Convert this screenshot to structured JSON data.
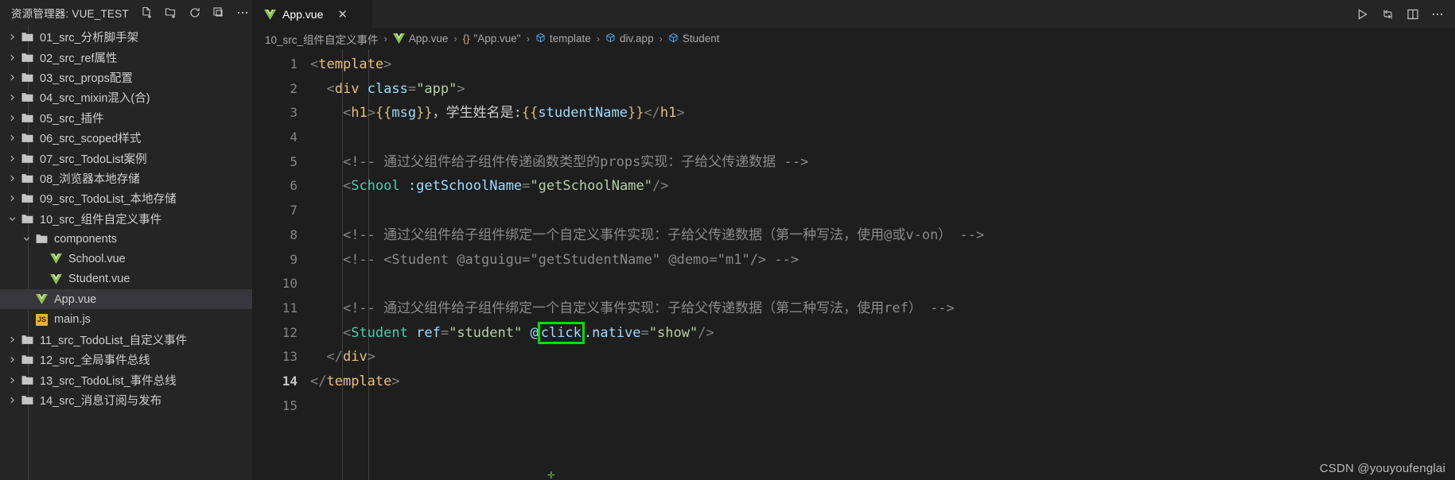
{
  "sidebar": {
    "title": "资源管理器: VUE_TEST",
    "actions": [
      {
        "name": "new-file-icon",
        "tooltip": "新建文件"
      },
      {
        "name": "new-folder-icon",
        "tooltip": "新建文件夹"
      },
      {
        "name": "refresh-icon",
        "tooltip": "刷新资源管理器"
      },
      {
        "name": "collapse-all-icon",
        "tooltip": "在资源管理器中折叠文件夹"
      },
      {
        "name": "more-actions-icon",
        "tooltip": "视图和更多操作"
      }
    ],
    "items": [
      {
        "label": "01_src_分析脚手架",
        "type": "folder",
        "expanded": false,
        "indent": 1,
        "selected": false
      },
      {
        "label": "02_src_ref属性",
        "type": "folder",
        "expanded": false,
        "indent": 1,
        "selected": false
      },
      {
        "label": "03_src_props配置",
        "type": "folder",
        "expanded": false,
        "indent": 1,
        "selected": false
      },
      {
        "label": "04_src_mixin混入(合)",
        "type": "folder",
        "expanded": false,
        "indent": 1,
        "selected": false
      },
      {
        "label": "05_src_插件",
        "type": "folder",
        "expanded": false,
        "indent": 1,
        "selected": false
      },
      {
        "label": "06_src_scoped样式",
        "type": "folder",
        "expanded": false,
        "indent": 1,
        "selected": false
      },
      {
        "label": "07_src_TodoList案例",
        "type": "folder",
        "expanded": false,
        "indent": 1,
        "selected": false
      },
      {
        "label": "08_浏览器本地存储",
        "type": "folder",
        "expanded": false,
        "indent": 1,
        "selected": false
      },
      {
        "label": "09_src_TodoList_本地存储",
        "type": "folder",
        "expanded": false,
        "indent": 1,
        "selected": false
      },
      {
        "label": "10_src_组件自定义事件",
        "type": "folder",
        "expanded": true,
        "indent": 1,
        "selected": false
      },
      {
        "label": "components",
        "type": "folder",
        "expanded": true,
        "indent": 2,
        "selected": false
      },
      {
        "label": "School.vue",
        "type": "vue",
        "indent": 3,
        "selected": false
      },
      {
        "label": "Student.vue",
        "type": "vue",
        "indent": 3,
        "selected": false
      },
      {
        "label": "App.vue",
        "type": "vue",
        "indent": 2,
        "selected": true
      },
      {
        "label": "main.js",
        "type": "js",
        "indent": 2,
        "selected": false
      },
      {
        "label": "11_src_TodoList_自定义事件",
        "type": "folder",
        "expanded": false,
        "indent": 1,
        "selected": false
      },
      {
        "label": "12_src_全局事件总线",
        "type": "folder",
        "expanded": false,
        "indent": 1,
        "selected": false
      },
      {
        "label": "13_src_TodoList_事件总线",
        "type": "folder",
        "expanded": false,
        "indent": 1,
        "selected": false
      },
      {
        "label": "14_src_消息订阅与发布",
        "type": "folder",
        "expanded": false,
        "indent": 1,
        "selected": false
      }
    ]
  },
  "tabs": {
    "active": {
      "label": "App.vue",
      "icon": "vue-icon",
      "close": "✕"
    },
    "actions": [
      {
        "name": "run-icon",
        "label": "▷"
      },
      {
        "name": "split-run-icon",
        "label": ""
      },
      {
        "name": "split-editor-icon",
        "label": ""
      },
      {
        "name": "more-editor-actions-icon",
        "label": "⋯"
      }
    ]
  },
  "breadcrumb": [
    {
      "label": "10_src_组件自定义事件",
      "icon": "none"
    },
    {
      "label": "App.vue",
      "icon": "vue-icon"
    },
    {
      "label": "\"App.vue\"",
      "icon": "braces-icon"
    },
    {
      "label": "template",
      "icon": "cube-icon"
    },
    {
      "label": "div.app",
      "icon": "cube-icon"
    },
    {
      "label": "Student",
      "icon": "cube-icon"
    }
  ],
  "editor": {
    "line_numbers": [
      "1",
      "2",
      "3",
      "4",
      "5",
      "6",
      "7",
      "8",
      "9",
      "10",
      "11",
      "12",
      "13",
      "14",
      "15"
    ],
    "active_line": 14,
    "highlight_color": "#00dd00",
    "highlighted_token": "click",
    "lines": [
      {
        "n": 1,
        "text": "<template>"
      },
      {
        "n": 2,
        "text": "  <div class=\"app\">"
      },
      {
        "n": 3,
        "text": "    <h1>{{msg}}，学生姓名是:{{studentName}}</h1>"
      },
      {
        "n": 4,
        "text": ""
      },
      {
        "n": 5,
        "text": "    <!-- 通过父组件给子组件传递函数类型的props实现：子给父传递数据 -->"
      },
      {
        "n": 6,
        "text": "    <School :getSchoolName=\"getSchoolName\"/>"
      },
      {
        "n": 7,
        "text": ""
      },
      {
        "n": 8,
        "text": "    <!-- 通过父组件给子组件绑定一个自定义事件实现：子给父传递数据（第一种写法，使用@或v-on） -->"
      },
      {
        "n": 9,
        "text": "    <!-- <Student @atguigu=\"getStudentName\" @demo=\"m1\"/> -->"
      },
      {
        "n": 10,
        "text": ""
      },
      {
        "n": 11,
        "text": "    <!-- 通过父组件给子组件绑定一个自定义事件实现：子给父传递数据（第二种写法，使用ref） -->"
      },
      {
        "n": 12,
        "text": "    <Student ref=\"student\" @click.native=\"show\"/>"
      },
      {
        "n": 13,
        "text": "  </div>"
      },
      {
        "n": 14,
        "text": "</template>"
      },
      {
        "n": 15,
        "text": ""
      }
    ]
  },
  "watermark": "CSDN @youyoufenglai"
}
